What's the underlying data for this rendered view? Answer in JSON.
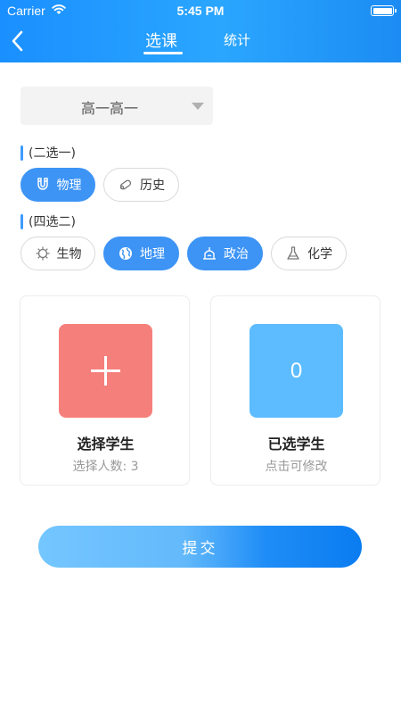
{
  "status": {
    "carrier": "Carrier",
    "time": "5:45 PM"
  },
  "nav": {
    "tabs": [
      {
        "label": "选课",
        "selected": true
      },
      {
        "label": "统计",
        "selected": false
      }
    ]
  },
  "class_select": {
    "value": "高一高一"
  },
  "groups": [
    {
      "label": "(二选一)",
      "options": [
        {
          "label": "物理",
          "icon": "magnet-icon",
          "selected": true
        },
        {
          "label": "历史",
          "icon": "scroll-icon",
          "selected": false
        }
      ]
    },
    {
      "label": "(四选二)",
      "options": [
        {
          "label": "生物",
          "icon": "virus-icon",
          "selected": false
        },
        {
          "label": "地理",
          "icon": "globe-icon",
          "selected": true
        },
        {
          "label": "政治",
          "icon": "government-icon",
          "selected": true
        },
        {
          "label": "化学",
          "icon": "flask-icon",
          "selected": false
        }
      ]
    }
  ],
  "cards": {
    "select_students": {
      "title": "选择学生",
      "subtitle": "选择人数: 3",
      "icon": "plus-icon"
    },
    "selected_students": {
      "title": "已选学生",
      "subtitle": "点击可修改",
      "count": "0"
    }
  },
  "submit": {
    "label": "提交"
  },
  "colors": {
    "primary": "#3d94f5",
    "add_tile": "#f57f7b",
    "count_tile": "#5cbcff"
  }
}
